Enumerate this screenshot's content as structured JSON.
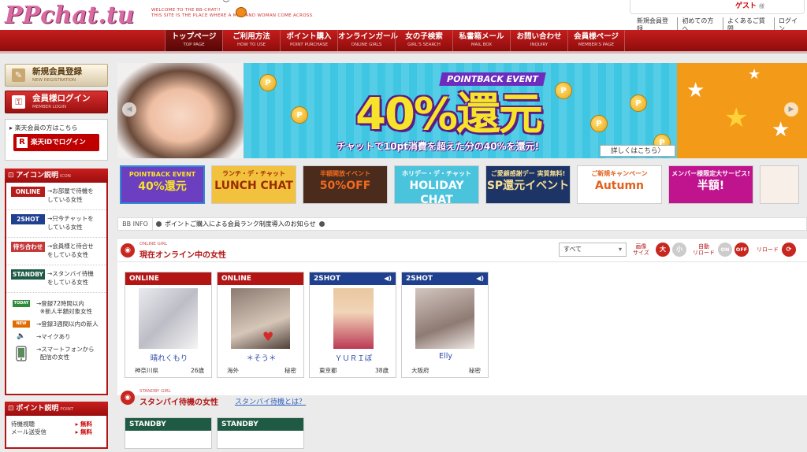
{
  "header": {
    "logo": "PPchat.tu",
    "tagline": [
      "WELCOME TO THE BB-CHAT!!",
      "THIS SITE IS THE PLACE WHERE A MAN AND WOMAN COME ACROSS."
    ],
    "guest_name": "ゲスト",
    "guest_suffix": "様",
    "top_links": [
      "新規会員登録",
      "初めての方へ",
      "よくあるご質問",
      "ログイン"
    ]
  },
  "nav": [
    {
      "label": "トップページ",
      "sub": "TOP PAGE"
    },
    {
      "label": "ご利用方法",
      "sub": "HOW TO USE"
    },
    {
      "label": "ポイント購入",
      "sub": "POINT PURCHASE"
    },
    {
      "label": "オンラインガール",
      "sub": "ONLINE GIRLS"
    },
    {
      "label": "女の子検索",
      "sub": "GIRL'S SEARCH"
    },
    {
      "label": "私書箱メール",
      "sub": "MAIL BOX"
    },
    {
      "label": "お問い合わせ",
      "sub": "INQUIRY"
    },
    {
      "label": "会員様ページ",
      "sub": "MEMBER'S PAGE"
    }
  ],
  "sidebar": {
    "register": {
      "label": "新規会員登録",
      "sub": "NEW REGISTRATION"
    },
    "login": {
      "label": "会員様ログイン",
      "sub": "MEMBER LOGIN"
    },
    "rakuten_note": "楽天会員の方はこちら",
    "rakuten_button": "楽天IDでログイン",
    "icon_panel": {
      "title": "アイコン説明",
      "title_en": "ICON",
      "statuses": [
        {
          "tag": "ONLINE",
          "desc": [
            "お部屋で待機を",
            "している女性"
          ]
        },
        {
          "tag": "2SHOT",
          "desc": [
            "只今チャットを",
            "している女性"
          ]
        },
        {
          "tag": "待ち合わせ",
          "desc": [
            "会員様と待合せ",
            "をしている女性"
          ]
        },
        {
          "tag": "STANDBY",
          "desc": [
            "スタンバイ待機",
            "をしている女性"
          ]
        }
      ],
      "legend": [
        {
          "icon": "TODAY",
          "text": [
            "登録72時間以内",
            "※新人半額対象女性"
          ]
        },
        {
          "icon": "NEW",
          "text": [
            "登録3週間以内の新人"
          ]
        },
        {
          "icon": "mic-icon",
          "text": [
            "マイクあり"
          ]
        },
        {
          "icon": "smartphone-icon",
          "text": [
            "スマートフォンから",
            "配信の女性"
          ]
        }
      ]
    },
    "point_panel": {
      "title": "ポイント説明",
      "title_en": "POINT",
      "rows": [
        {
          "label": "待機視聴",
          "value": "無料"
        },
        {
          "label": "メール送受信",
          "value": "無料"
        }
      ]
    }
  },
  "banner": {
    "event": "POINTBACK EVENT",
    "headline": "40%還元",
    "subline": "チャットで10pt消費を超えた分の40%を還元!",
    "more": "詳しくはこちら〉",
    "coin_letter": "P"
  },
  "thumbnails": [
    {
      "l1": "POINTBACK EVENT",
      "l2": "40%還元"
    },
    {
      "l1": "ランチ・デ・チャット",
      "l2": "LUNCH CHAT"
    },
    {
      "l1": "半額開放イベント",
      "l2": "50%OFF"
    },
    {
      "l1": "ホリデー・デ・チャット",
      "l2": "HOLIDAY CHAT"
    },
    {
      "l1": "ご愛顧感謝デー 実質無料!",
      "l2": "SP還元イベント"
    },
    {
      "l1": "ご新規キャンペーン",
      "l2": "Autumn"
    },
    {
      "l1": "メンバー様限定大サービス!",
      "l2": "半額!"
    }
  ],
  "bbinfo": {
    "label": "BB INFO",
    "text": "ポイントご購入による会員ランク制度導入のお知らせ"
  },
  "online_section": {
    "title_en": "ONLINE GIRL",
    "title": "現在オンライン中の女性",
    "sort_value": "すべて",
    "image_size_label": [
      "画像",
      "サイズ"
    ],
    "size_large": "大",
    "size_small": "小",
    "auto_reload_label": [
      "自動",
      "リロード"
    ],
    "on_label": "ON",
    "off_label": "OFF",
    "reload_label": "リロード",
    "cards": [
      {
        "status": "ONLINE",
        "name": "晴れくもり",
        "area": "神奈川県",
        "age": "26歳"
      },
      {
        "status": "ONLINE",
        "name": "＊そう＊",
        "area": "海外",
        "age": "秘密"
      },
      {
        "status": "2SHOT",
        "name": "ＹＵＲＩぽ",
        "area": "東京都",
        "age": "38歳"
      },
      {
        "status": "2SHOT",
        "name": "Elly",
        "area": "大阪府",
        "age": "秘密"
      }
    ]
  },
  "standby_section": {
    "title_en": "STANDBY GIRL",
    "title": "スタンバイ待機の女性",
    "link": "スタンバイ待機とは？",
    "cards": [
      {
        "status": "STANDBY"
      },
      {
        "status": "STANDBY"
      }
    ]
  }
}
